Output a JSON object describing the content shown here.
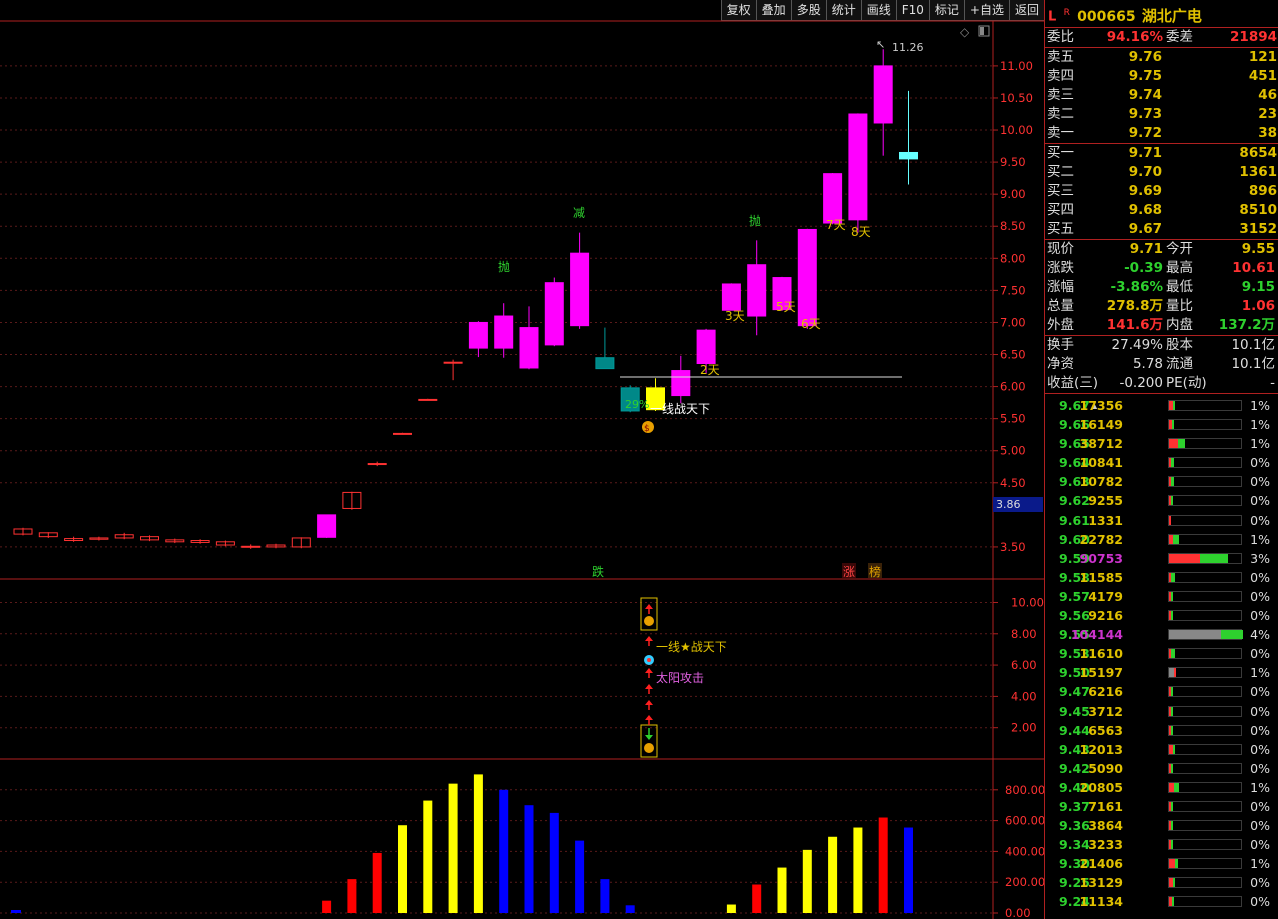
{
  "toolbar": {
    "buttons": [
      "复权",
      "叠加",
      "多股",
      "统计",
      "画线",
      "F10",
      "标记",
      "+自选",
      "返回"
    ]
  },
  "stock": {
    "market": "L",
    "flag": "R",
    "code": "000665",
    "name": "湖北广电"
  },
  "summary": {
    "wb_label": "委比",
    "wb_value": "94.16%",
    "wc_label": "委差",
    "wc_value": "21894"
  },
  "asks": [
    {
      "label": "卖五",
      "price": "9.76",
      "vol": "121"
    },
    {
      "label": "卖四",
      "price": "9.75",
      "vol": "451"
    },
    {
      "label": "卖三",
      "price": "9.74",
      "vol": "46"
    },
    {
      "label": "卖二",
      "price": "9.73",
      "vol": "23"
    },
    {
      "label": "卖一",
      "price": "9.72",
      "vol": "38"
    }
  ],
  "bids": [
    {
      "label": "买一",
      "price": "9.71",
      "vol": "8654"
    },
    {
      "label": "买二",
      "price": "9.70",
      "vol": "1361"
    },
    {
      "label": "买三",
      "price": "9.69",
      "vol": "896"
    },
    {
      "label": "买四",
      "price": "9.68",
      "vol": "8510"
    },
    {
      "label": "买五",
      "price": "9.67",
      "vol": "3152"
    }
  ],
  "quote": [
    {
      "l1": "现价",
      "v1": "9.71",
      "c1": "#e0c000",
      "l2": "今开",
      "v2": "9.55",
      "c2": "#e0c000"
    },
    {
      "l1": "涨跌",
      "v1": "-0.39",
      "c1": "#2ed12e",
      "l2": "最高",
      "v2": "10.61",
      "c2": "#ff3232"
    },
    {
      "l1": "涨幅",
      "v1": "-3.86%",
      "c1": "#2ed12e",
      "l2": "最低",
      "v2": "9.15",
      "c2": "#2ed12e"
    },
    {
      "l1": "总量",
      "v1": "278.8万",
      "c1": "#e0c000",
      "l2": "量比",
      "v2": "1.06",
      "c2": "#ff3232"
    },
    {
      "l1": "外盘",
      "v1": "141.6万",
      "c1": "#ff3232",
      "l2": "内盘",
      "v2": "137.2万",
      "c2": "#2ed12e"
    }
  ],
  "fin": [
    {
      "l1": "换手",
      "v1": "27.49%",
      "l2": "股本",
      "v2": "10.1亿"
    },
    {
      "l1": "净资",
      "v1": "5.78",
      "l2": "流通",
      "v2": "10.1亿"
    },
    {
      "l1": "收益(三)",
      "v1": "-0.200",
      "l2": "PE(动)",
      "v2": "-"
    }
  ],
  "dist": [
    {
      "p": "9.67",
      "v": "17356",
      "pct": "1%",
      "r": 0.05,
      "g": 0.02,
      "mark": "▲"
    },
    {
      "p": "9.66",
      "v": "16149",
      "pct": "1%",
      "r": 0.04,
      "g": 0.03
    },
    {
      "p": "9.65",
      "v": "38712",
      "pct": "1%",
      "r": 0.12,
      "g": 0.1
    },
    {
      "p": "9.64",
      "v": "10841",
      "pct": "0%",
      "r": 0.02,
      "g": 0.04
    },
    {
      "p": "9.63",
      "v": "10782",
      "pct": "0%",
      "r": 0.02,
      "g": 0.04
    },
    {
      "p": "9.62",
      "v": "9255",
      "pct": "0%",
      "r": 0.02,
      "g": 0.03
    },
    {
      "p": "9.61",
      "v": "1331",
      "pct": "0%",
      "r": 0.01,
      "g": 0
    },
    {
      "p": "9.60",
      "v": "22782",
      "pct": "1%",
      "r": 0.06,
      "g": 0.08
    },
    {
      "p": "9.59",
      "v": "90753",
      "pct": "3%",
      "r": 0.42,
      "g": 0.38,
      "hl": true
    },
    {
      "p": "9.58",
      "v": "11585",
      "pct": "0%",
      "r": 0.02,
      "g": 0.05
    },
    {
      "p": "9.57",
      "v": "4179",
      "pct": "0%",
      "r": 0.01,
      "g": 0.02
    },
    {
      "p": "9.56",
      "v": "9216",
      "pct": "0%",
      "r": 0.02,
      "g": 0.03
    },
    {
      "p": "9.55",
      "v": "104144",
      "pct": "4%",
      "r": 0,
      "g": 0.3,
      "gr": 0.7,
      "hl": true
    },
    {
      "p": "9.53",
      "v": "11610",
      "pct": "0%",
      "r": 0.02,
      "g": 0.05
    },
    {
      "p": "9.50",
      "v": "15197",
      "pct": "1%",
      "r": 0.02,
      "g": 0,
      "gr": 0.07
    },
    {
      "p": "9.47",
      "v": "6216",
      "pct": "0%",
      "r": 0.02,
      "g": 0.02
    },
    {
      "p": "9.45",
      "v": "3712",
      "pct": "0%",
      "r": 0.01,
      "g": 0.02
    },
    {
      "p": "9.44",
      "v": "6563",
      "pct": "0%",
      "r": 0.02,
      "g": 0.02
    },
    {
      "p": "9.43",
      "v": "12013",
      "pct": "0%",
      "r": 0.05,
      "g": 0.01
    },
    {
      "p": "9.42",
      "v": "5090",
      "pct": "0%",
      "r": 0.02,
      "g": 0.01
    },
    {
      "p": "9.40",
      "v": "20805",
      "pct": "1%",
      "r": 0.07,
      "g": 0.06
    },
    {
      "p": "9.37",
      "v": "7161",
      "pct": "0%",
      "r": 0.03,
      "g": 0.01
    },
    {
      "p": "9.36",
      "v": "3864",
      "pct": "0%",
      "r": 0.01,
      "g": 0.01
    },
    {
      "p": "9.34",
      "v": "3233",
      "pct": "0%",
      "r": 0.01,
      "g": 0.01
    },
    {
      "p": "9.30",
      "v": "21406",
      "pct": "1%",
      "r": 0.08,
      "g": 0.04
    },
    {
      "p": "9.25",
      "v": "13129",
      "pct": "0%",
      "r": 0.05,
      "g": 0.01
    },
    {
      "p": "9.24",
      "v": "11134",
      "pct": "0%",
      "r": 0.04,
      "g": 0.01
    }
  ],
  "chart_data": [
    {
      "type": "candlestick",
      "yticks": [
        11.0,
        10.5,
        10.0,
        9.5,
        9.0,
        8.5,
        8.0,
        7.5,
        7.0,
        6.5,
        6.0,
        5.5,
        5.0,
        4.5,
        3.5
      ],
      "ylim": [
        3.0,
        11.7
      ],
      "current_price_tag": "3.86",
      "high_label": "11.26",
      "candles": [
        {
          "o": 3.7,
          "c": 3.78,
          "h": 3.8,
          "l": 3.68
        },
        {
          "o": 3.66,
          "c": 3.72,
          "h": 3.73,
          "l": 3.64
        },
        {
          "o": 3.6,
          "c": 3.63,
          "h": 3.66,
          "l": 3.58
        },
        {
          "o": 3.62,
          "c": 3.64,
          "h": 3.66,
          "l": 3.6
        },
        {
          "o": 3.64,
          "c": 3.69,
          "h": 3.72,
          "l": 3.62
        },
        {
          "o": 3.61,
          "c": 3.66,
          "h": 3.68,
          "l": 3.59
        },
        {
          "o": 3.58,
          "c": 3.61,
          "h": 3.63,
          "l": 3.56
        },
        {
          "o": 3.57,
          "c": 3.6,
          "h": 3.62,
          "l": 3.55
        },
        {
          "o": 3.53,
          "c": 3.58,
          "h": 3.6,
          "l": 3.51
        },
        {
          "o": 3.51,
          "c": 3.51,
          "h": 3.54,
          "l": 3.47
        },
        {
          "o": 3.5,
          "c": 3.53,
          "h": 3.55,
          "l": 3.48
        },
        {
          "o": 3.5,
          "c": 3.64,
          "h": 3.65,
          "l": 3.48
        },
        {
          "o": 3.65,
          "c": 4.0,
          "h": 4.0,
          "l": 3.64
        },
        {
          "o": 4.1,
          "c": 4.35,
          "h": 4.36,
          "l": 4.08
        },
        {
          "o": 4.8,
          "c": 4.8,
          "h": 4.83,
          "l": 4.76
        },
        {
          "o": 5.27,
          "c": 5.27,
          "h": 5.28,
          "l": 5.26
        },
        {
          "o": 5.8,
          "c": 5.8,
          "h": 5.81,
          "l": 5.79
        },
        {
          "o": 6.38,
          "c": 6.38,
          "h": 6.42,
          "l": 6.1
        },
        {
          "o": 6.6,
          "c": 7.0,
          "h": 7.02,
          "l": 6.46
        },
        {
          "o": 6.6,
          "c": 7.1,
          "h": 7.3,
          "l": 6.45
        },
        {
          "o": 6.29,
          "c": 6.92,
          "h": 7.25,
          "l": 6.27
        },
        {
          "o": 6.65,
          "c": 7.62,
          "h": 7.7,
          "l": 6.63
        },
        {
          "o": 6.95,
          "c": 8.08,
          "h": 8.4,
          "l": 6.9
        },
        {
          "o": 6.45,
          "c": 6.28,
          "h": 6.92,
          "l": 6.28
        },
        {
          "o": 5.62,
          "c": 5.98,
          "h": 6.02,
          "l": 5.6
        },
        {
          "o": 5.98,
          "c": 5.64,
          "h": 6.13,
          "l": 5.62
        },
        {
          "o": 5.86,
          "c": 6.25,
          "h": 6.48,
          "l": 5.74
        },
        {
          "o": 6.36,
          "c": 6.88,
          "h": 6.9,
          "l": 6.2
        },
        {
          "o": 7.19,
          "c": 7.6,
          "h": 7.61,
          "l": 7.19
        },
        {
          "o": 7.1,
          "c": 7.9,
          "h": 8.28,
          "l": 6.8
        },
        {
          "o": 7.2,
          "c": 7.7,
          "h": 7.71,
          "l": 7.18
        },
        {
          "o": 6.95,
          "c": 8.45,
          "h": 8.46,
          "l": 6.9
        },
        {
          "o": 8.55,
          "c": 9.32,
          "h": 9.33,
          "l": 8.53
        },
        {
          "o": 8.6,
          "c": 10.25,
          "h": 10.26,
          "l": 8.4
        },
        {
          "o": 10.11,
          "c": 11.0,
          "h": 11.26,
          "l": 9.6
        },
        {
          "o": 9.65,
          "c": 9.55,
          "h": 10.61,
          "l": 9.15
        }
      ],
      "annotations": [
        "抛",
        "减",
        "抛",
        "29%",
        "一线战天下",
        "2天",
        "3天",
        "5天",
        "6天",
        "7天",
        "8天",
        "跌",
        "涨",
        "榜"
      ]
    },
    {
      "type": "signal",
      "yticks": [
        10.0,
        8.0,
        6.0,
        4.0,
        2.0
      ],
      "ylim": [
        0,
        11.5
      ],
      "labels": [
        "一线★战天下",
        "太阳攻击"
      ]
    },
    {
      "type": "bar",
      "yticks": [
        800,
        600,
        400,
        200,
        0
      ],
      "ylabels": [
        "800.00",
        "600.00",
        "400.00",
        "200.00",
        "0.00"
      ],
      "ylim": [
        0,
        1000
      ],
      "bars": [
        {
          "i": 12,
          "v": 80,
          "c": "red"
        },
        {
          "i": 13,
          "v": 220,
          "c": "red"
        },
        {
          "i": 14,
          "v": 390,
          "c": "red"
        },
        {
          "i": 15,
          "v": 570,
          "c": "yellow"
        },
        {
          "i": 16,
          "v": 730,
          "c": "yellow"
        },
        {
          "i": 17,
          "v": 840,
          "c": "yellow"
        },
        {
          "i": 18,
          "v": 900,
          "c": "yellow"
        },
        {
          "i": 19,
          "v": 800,
          "c": "blue"
        },
        {
          "i": 20,
          "v": 700,
          "c": "blue"
        },
        {
          "i": 21,
          "v": 650,
          "c": "blue"
        },
        {
          "i": 22,
          "v": 470,
          "c": "blue"
        },
        {
          "i": 23,
          "v": 220,
          "c": "blue"
        },
        {
          "i": 24,
          "v": 50,
          "c": "blue"
        },
        {
          "i": 28,
          "v": 55,
          "c": "yellow"
        },
        {
          "i": 29,
          "v": 185,
          "c": "red"
        },
        {
          "i": 30,
          "v": 295,
          "c": "yellow"
        },
        {
          "i": 31,
          "v": 410,
          "c": "yellow"
        },
        {
          "i": 32,
          "v": 495,
          "c": "yellow"
        },
        {
          "i": 33,
          "v": 555,
          "c": "yellow"
        },
        {
          "i": 34,
          "v": 620,
          "c": "red"
        },
        {
          "i": 35,
          "v": 555,
          "c": "blue"
        }
      ]
    }
  ]
}
